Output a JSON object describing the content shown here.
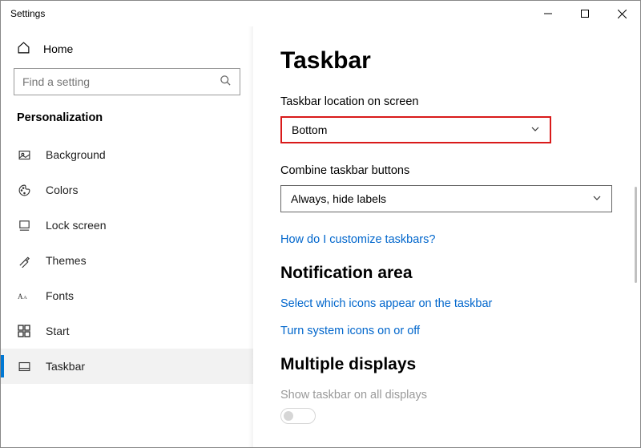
{
  "window": {
    "title": "Settings"
  },
  "sidebar": {
    "home_label": "Home",
    "search_placeholder": "Find a setting",
    "category": "Personalization",
    "items": [
      {
        "label": "Background"
      },
      {
        "label": "Colors"
      },
      {
        "label": "Lock screen"
      },
      {
        "label": "Themes"
      },
      {
        "label": "Fonts"
      },
      {
        "label": "Start"
      },
      {
        "label": "Taskbar"
      }
    ]
  },
  "content": {
    "title": "Taskbar",
    "location_label": "Taskbar location on screen",
    "location_value": "Bottom",
    "combine_label": "Combine taskbar buttons",
    "combine_value": "Always, hide labels",
    "customize_link": "How do I customize taskbars?",
    "notif_heading": "Notification area",
    "notif_link1": "Select which icons appear on the taskbar",
    "notif_link2": "Turn system icons on or off",
    "multi_heading": "Multiple displays",
    "multi_disabled": "Show taskbar on all displays"
  }
}
